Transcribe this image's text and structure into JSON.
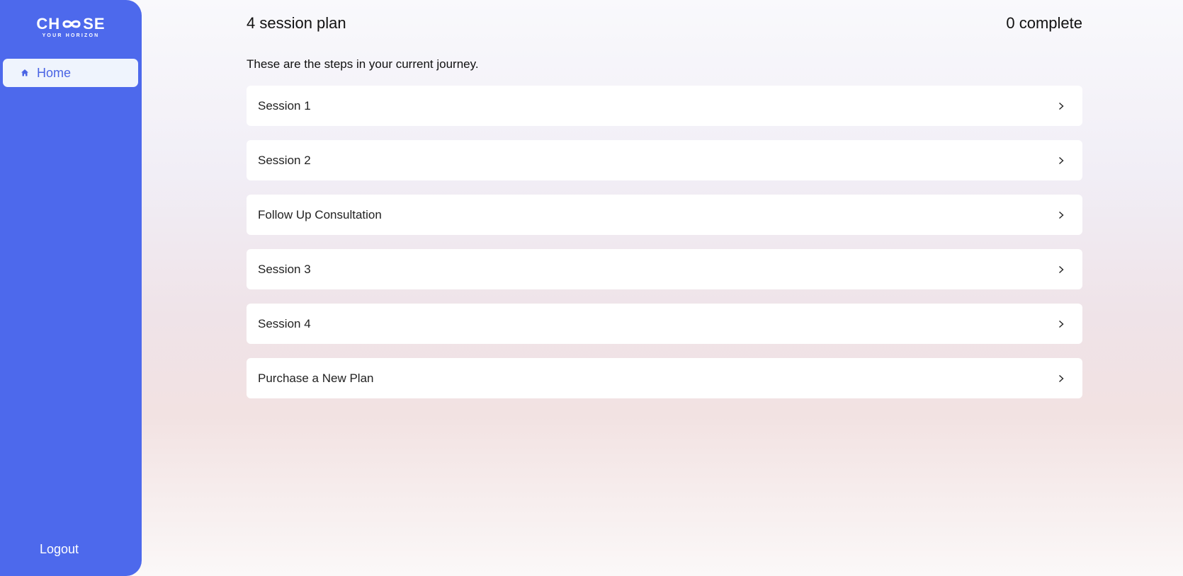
{
  "sidebar": {
    "logo": {
      "main": "CHOOSE",
      "sub": "YOUR HORIZON",
      "icon": "infinity-icon"
    },
    "nav": [
      {
        "label": "Home",
        "icon": "home-icon",
        "active": true
      }
    ],
    "logout_label": "Logout"
  },
  "header": {
    "plan_title": "4 session plan",
    "complete_text": "0 complete"
  },
  "main": {
    "intro": "These are the steps in your current journey.",
    "steps": [
      {
        "label": "Session 1"
      },
      {
        "label": "Session 2"
      },
      {
        "label": "Follow Up Consultation"
      },
      {
        "label": "Session 3"
      },
      {
        "label": "Session 4"
      },
      {
        "label": "Purchase a New Plan"
      }
    ]
  },
  "colors": {
    "sidebar_bg": "#4d69ec",
    "nav_active_bg": "#eff4fd",
    "nav_active_text": "#4a64e4"
  }
}
